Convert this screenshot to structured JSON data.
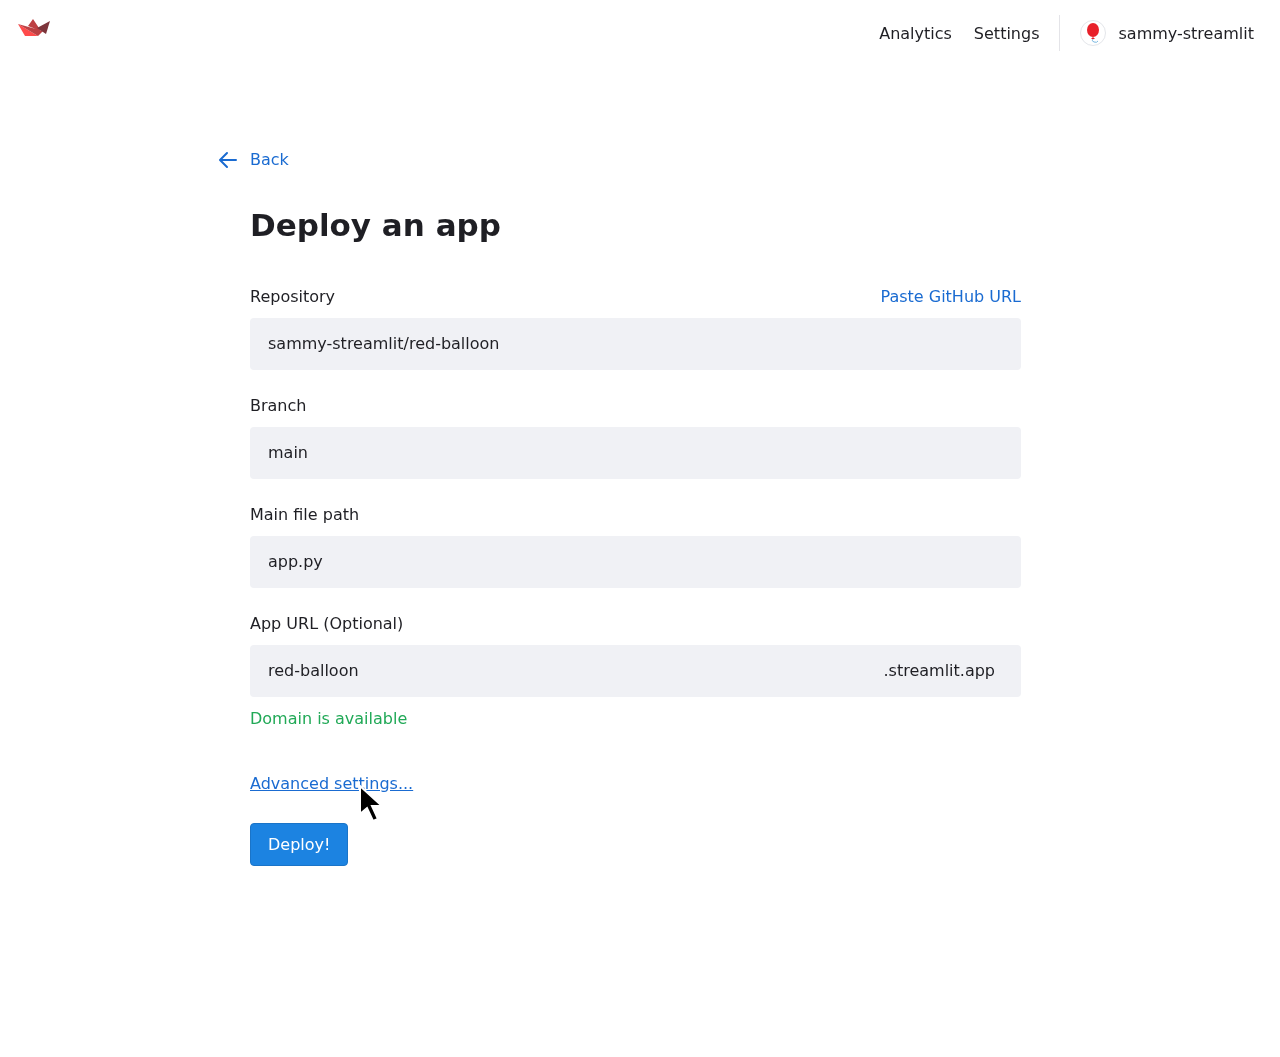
{
  "nav": {
    "links": [
      "Analytics",
      "Settings"
    ],
    "user": "sammy-streamlit"
  },
  "back": "Back",
  "title": "Deploy an app",
  "fields": [
    {
      "label": "Repository",
      "value": "sammy-streamlit/red-balloon",
      "action": "Paste GitHub URL"
    },
    {
      "label": "Branch",
      "value": "main"
    },
    {
      "label": "Main file path",
      "value": "app.py"
    },
    {
      "label": "App URL (Optional)",
      "value": "red-balloon",
      "suffix": ".streamlit.app",
      "status": {
        "text": "Domain is available",
        "kind": "success"
      }
    }
  ],
  "advanced_link": "Advanced settings...",
  "submit": "Deploy!"
}
